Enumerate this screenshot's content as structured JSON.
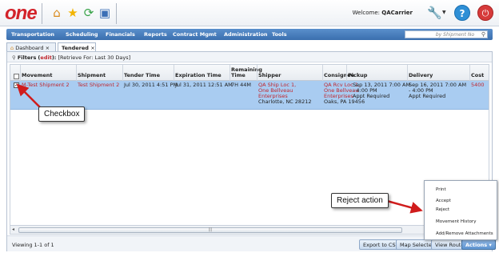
{
  "header": {
    "logo": "one",
    "welcome_prefix": "Welcome:",
    "welcome_user": "QACarrier",
    "help_glyph": "?",
    "icons": [
      "home-icon",
      "star-icon",
      "refresh-icon",
      "monitor-icon",
      "wrench-icon",
      "help-icon",
      "power-icon"
    ]
  },
  "nav": {
    "items": [
      "Transportation",
      "Scheduling",
      "Financials",
      "Reports",
      "Contract Mgmt",
      "Administration",
      "Tools"
    ],
    "search_placeholder": "by Shipment No"
  },
  "tabs": [
    {
      "label": "Dashboard",
      "close": "×"
    },
    {
      "label": "Tendered",
      "close": "×"
    }
  ],
  "filters": {
    "label": "Filters",
    "edit_open": "(",
    "edit": "edit",
    "edit_close": "):",
    "retrieve": "[Retrieve For: Last 30 Days]"
  },
  "table": {
    "headers": {
      "movement": "Movement",
      "shipment": "Shipment",
      "tender_time": "Tender Time",
      "expiration_time": "Expiration Time",
      "remaining_1": "Remaining",
      "remaining_2": "Time",
      "shipper": "Shipper",
      "consignee": "Consignee",
      "pickup": "Pickup",
      "delivery": "Delivery",
      "cost": "Cost"
    },
    "row": {
      "checked": "✓",
      "movement": "M-Test Shipment 2",
      "shipment": "Test Shipment 2",
      "tender_time": "Jul 30, 2011 4:51 PM",
      "expiration_time": "Jul 31, 2011 12:51 AM",
      "remaining": "7H 44M",
      "shipper_1": "QA Ship Loc 1,",
      "shipper_2": "One Bellveau",
      "shipper_3": "Enterprises",
      "shipper_4": "Charlotte, NC 28212",
      "consignee_1": "QA Rcv Loc 1,",
      "consignee_2": "One Bellveau",
      "consignee_3": "Enterprises",
      "consignee_4": "Oaks, PA 19456",
      "pickup_1": "Sep 13, 2011 7:00 AM",
      "pickup_2": "- 4:00 PM",
      "pickup_3": "Appt Required",
      "delivery_1": "Sep 16, 2011 7:00 AM",
      "delivery_2": "- 4:00 PM",
      "delivery_3": "Appt Required",
      "cost": "5400"
    }
  },
  "footer": {
    "viewing": "Viewing 1-1 of 1",
    "export": "Export to CSV",
    "map": "Map Selected",
    "view_route": "View Route",
    "actions": "Actions ▾"
  },
  "actions_menu": [
    "Print",
    "Accept",
    "Reject",
    "Movement History",
    "Add/Remove Attachments"
  ],
  "annotations": {
    "checkbox": "Checkbox",
    "reject_action": "Reject action"
  },
  "colors": {
    "brand_red": "#d3232a",
    "nav_blue": "#3a6fae",
    "row_selected": "#a9ccf1",
    "link_red": "#c0262d"
  }
}
